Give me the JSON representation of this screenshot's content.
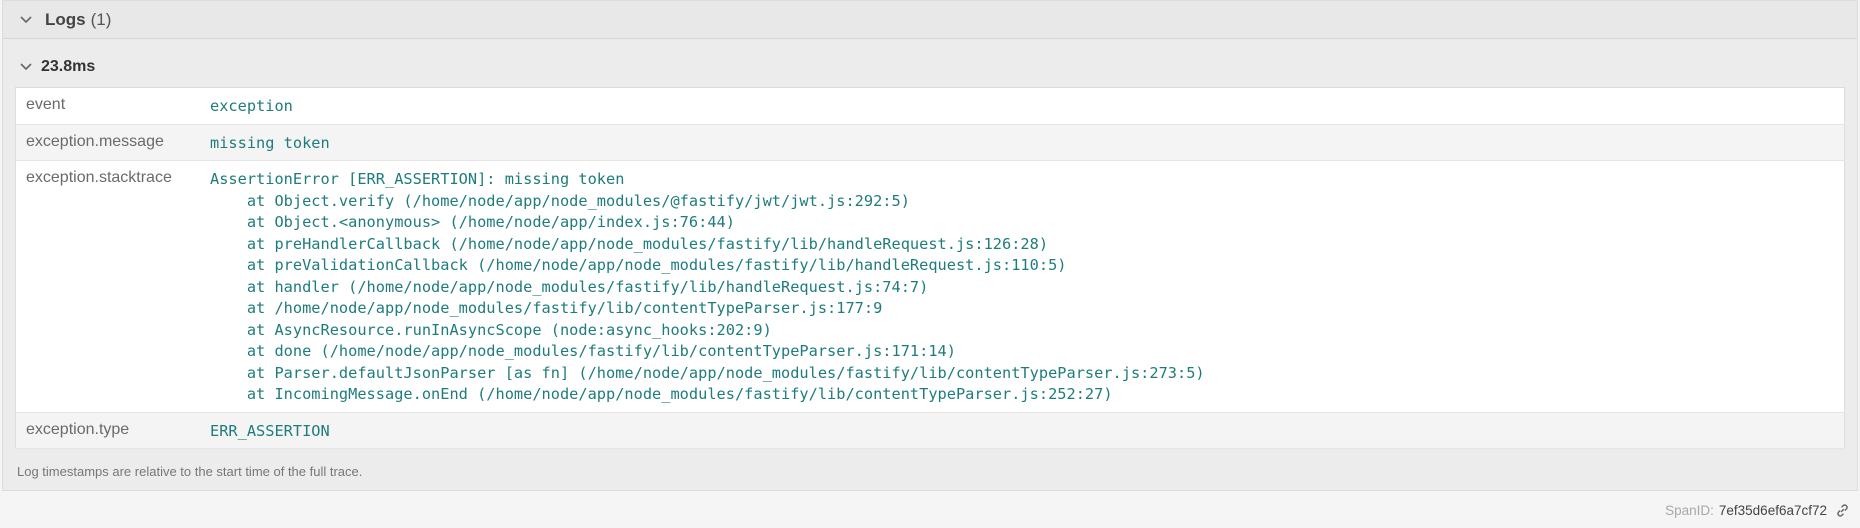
{
  "logs": {
    "title": "Logs",
    "count": "(1)",
    "collapse_icon": "chevron-down-icon"
  },
  "entry": {
    "time": "23.8ms",
    "fields": [
      {
        "key": "event",
        "value": "exception"
      },
      {
        "key": "exception.message",
        "value": "missing token"
      },
      {
        "key": "exception.stacktrace",
        "value": "AssertionError [ERR_ASSERTION]: missing token\n    at Object.verify (/home/node/app/node_modules/@fastify/jwt/jwt.js:292:5)\n    at Object.<anonymous> (/home/node/app/index.js:76:44)\n    at preHandlerCallback (/home/node/app/node_modules/fastify/lib/handleRequest.js:126:28)\n    at preValidationCallback (/home/node/app/node_modules/fastify/lib/handleRequest.js:110:5)\n    at handler (/home/node/app/node_modules/fastify/lib/handleRequest.js:74:7)\n    at /home/node/app/node_modules/fastify/lib/contentTypeParser.js:177:9\n    at AsyncResource.runInAsyncScope (node:async_hooks:202:9)\n    at done (/home/node/app/node_modules/fastify/lib/contentTypeParser.js:171:14)\n    at Parser.defaultJsonParser [as fn] (/home/node/app/node_modules/fastify/lib/contentTypeParser.js:273:5)\n    at IncomingMessage.onEnd (/home/node/app/node_modules/fastify/lib/contentTypeParser.js:252:27)"
      },
      {
        "key": "exception.type",
        "value": "ERR_ASSERTION"
      }
    ]
  },
  "footnote": "Log timestamps are relative to the start time of the full trace.",
  "span": {
    "label": "SpanID:",
    "id": "7ef35d6ef6a7cf72",
    "icon": "link-icon"
  },
  "colors": {
    "value_text": "#1f7c7c",
    "key_text": "#6a6a6a"
  }
}
